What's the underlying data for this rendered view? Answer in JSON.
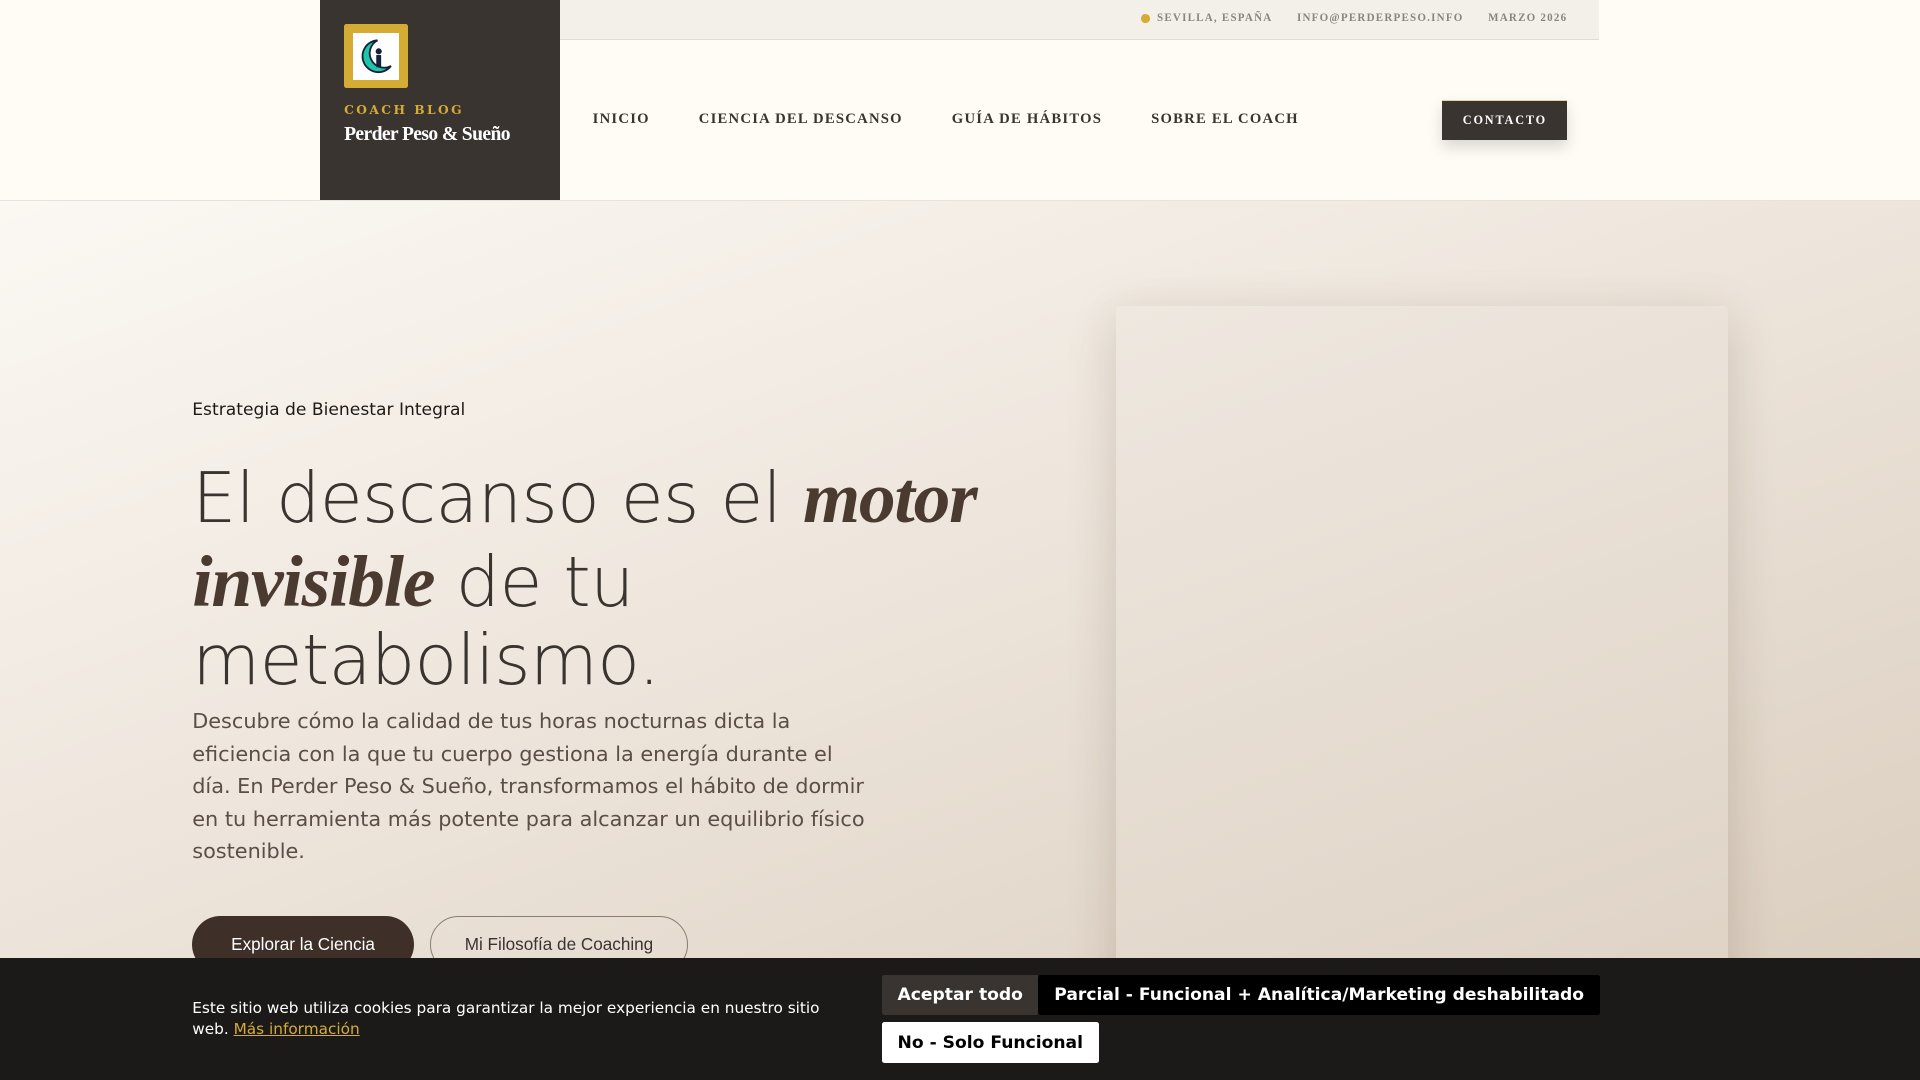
{
  "brand": {
    "subtitle": "COACH BLOG",
    "title": "Perder Peso & Sueño"
  },
  "topbar": {
    "location": "SEVILLA, ESPAÑA",
    "email": "INFO@PERDERPESO.INFO",
    "date": "MARZO 2026"
  },
  "nav": {
    "items": [
      "INICIO",
      "CIENCIA DEL DESCANSO",
      "GUÍA DE HÁBITOS",
      "SOBRE EL COACH"
    ],
    "contact": "CONTACTO"
  },
  "hero": {
    "eyebrow": "Estrategia de Bienestar Integral",
    "h1_a": "El descanso es el ",
    "h1_em1": "motor invisible",
    "h1_b": " de tu metabolismo.",
    "lead": "Descubre cómo la calidad de tus horas nocturnas dicta la eficiencia con la que tu cuerpo gestiona la energía durante el día. En Perder Peso & Sueño, transformamos el hábito de dormir en tu herramienta más potente para alcanzar un equilibrio físico sostenible.",
    "primary": "Explorar la Ciencia",
    "secondary": "Mi Filosofía de Coaching"
  },
  "cookie": {
    "text": "Este sitio web utiliza cookies para garantizar la mejor experiencia en nuestro sitio web. ",
    "link": "Más información",
    "accept": "Aceptar todo",
    "partial": "Parcial - Funcional + Analítica/Marketing deshabilitado",
    "reject": "No - Solo Funcional"
  },
  "colors": {
    "gold": "#d4ac34",
    "dark": "#3a3431"
  }
}
